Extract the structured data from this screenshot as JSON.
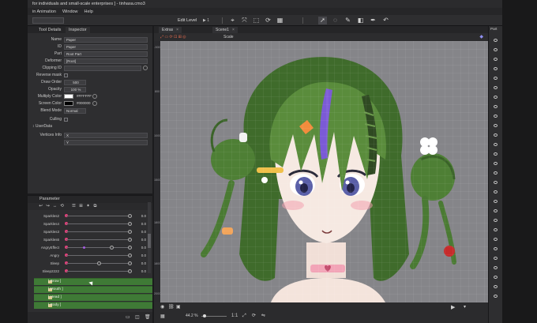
{
  "window": {
    "title": "for individuals and small-scale enterprises ] - tinhasa.cmo3",
    "menu": [
      "in Animation",
      "Window",
      "Help"
    ]
  },
  "toolbar": {
    "edit_level": "Edit Level",
    "edit_level_arrow": "▶ 1",
    "icons": [
      "selection-tool-icon",
      "deform-tool-icon",
      "warp-tool-icon",
      "rotate-tool-icon",
      "mesh-tool-icon",
      "arrow-tool-icon",
      "lasso-tool-icon",
      "brush-tool-icon",
      "eraser-tool-icon",
      "pen-tool-icon",
      "curve-tool-icon"
    ]
  },
  "inspector": {
    "tabs": [
      "Tool Details",
      "Inspector"
    ],
    "active_tab": "Inspector",
    "rows": {
      "name_label": "Name",
      "name_value": "Paper",
      "id_label": "ID",
      "id_value": "Paper",
      "part_label": "Part",
      "part_value": "Root Part",
      "deformer_label": "Deformer",
      "deformer_value": "[Root]",
      "clipping_label": "Clipping ID",
      "reverse_mask_label": "Reverse mask",
      "draw_order_label": "Draw Order",
      "draw_order_value": "500",
      "opacity_label": "Opacity",
      "opacity_value": "100 %",
      "multiply_label": "Multiply Color",
      "multiply_value": "#FFFFFF",
      "screen_label": "Screen Color",
      "screen_value": "#000000",
      "blend_label": "Blend Mode",
      "blend_value": "Normal",
      "culling_label": "Culling",
      "user_data_label": "↕ UserData",
      "vertices_label": "Vertices Info",
      "vertices_x": "X",
      "vertices_y": "Y"
    }
  },
  "parameters": {
    "title": "Parameter",
    "tools": [
      "↩",
      "↪",
      "↔",
      "⟲",
      "☰",
      "⊞",
      "✦",
      "⧉"
    ],
    "rows": [
      {
        "name": "Sparkles2",
        "value": "0.0"
      },
      {
        "name": "Sparkles4",
        "value": "0.0"
      },
      {
        "name": "Sparkles3",
        "value": "0.0"
      },
      {
        "name": "Sparkles6",
        "value": "0.0"
      },
      {
        "name": "AngryEffect",
        "value": "0.0"
      },
      {
        "name": "Angry",
        "value": "0.0"
      },
      {
        "name": "Sleep",
        "value": "0.0"
      },
      {
        "name": "Sleep2222",
        "value": "0.0"
      }
    ]
  },
  "parts": {
    "rows": [
      "[ Brow ]",
      "[ Mouth ]",
      "[ Head ]",
      "[ Body ]"
    ]
  },
  "view": {
    "tabs": [
      "Extras",
      "Scene1"
    ],
    "scale_label": "Scale",
    "ruler": [
      "-500",
      "800",
      "1000",
      "1500",
      "1800",
      "1800",
      "2000"
    ]
  },
  "status": {
    "zoom": "44.2 %",
    "ratio": "1:1"
  },
  "right_panel": {
    "title": "Part"
  },
  "colors": {
    "hair": "#4c7a34",
    "skin": "#f6e9e2",
    "accent": "#e0417a",
    "choker": "#f2a4b7"
  }
}
